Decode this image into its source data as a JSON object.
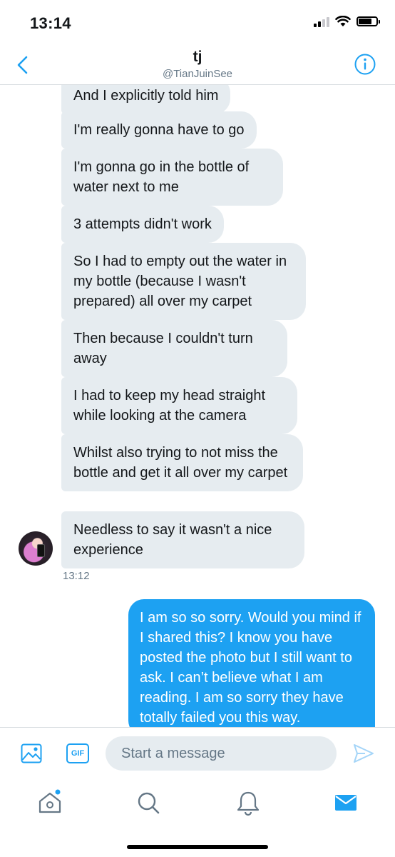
{
  "status_bar": {
    "time": "13:14",
    "battery_level": 0.75
  },
  "header": {
    "title": "tj",
    "handle": "@TianJuinSee"
  },
  "messages": [
    {
      "direction": "in",
      "text": "And I explicitly told him"
    },
    {
      "direction": "in",
      "text": "I'm really gonna have to go"
    },
    {
      "direction": "in",
      "text": "I'm gonna go in the bottle of water next to me"
    },
    {
      "direction": "in",
      "text": "3 attempts didn't work"
    },
    {
      "direction": "in",
      "text": "So I had to empty out the water in my bottle (because I wasn't prepared) all over my carpet"
    },
    {
      "direction": "in",
      "text": "Then because I couldn't turn away"
    },
    {
      "direction": "in",
      "text": "I had to keep my head straight while looking at the camera"
    },
    {
      "direction": "in",
      "text": "Whilst also trying to not miss the bottle and get it all over my carpet"
    },
    {
      "direction": "in",
      "text": "Needless to say it wasn't a nice experience"
    },
    {
      "direction": "out",
      "text": "I am so so sorry. Would you mind if I shared this? I know you have posted the photo but I still want to ask. I can’t believe what I am reading. I am so sorry they have totally failed you this way."
    }
  ],
  "incoming_timestamp": "13:12",
  "composer": {
    "gif_label": "GIF",
    "placeholder": "Start a message"
  },
  "icons": {
    "back": "chevron-left-icon",
    "info": "info-icon",
    "image": "image-icon",
    "gif": "gif-icon",
    "send": "send-icon",
    "home": "home-icon",
    "search": "search-icon",
    "notifications": "bell-icon",
    "messages": "mail-icon"
  },
  "colors": {
    "accent": "#1da1f2",
    "bubble_in": "#e6ecf0",
    "secondary_text": "#657786",
    "send_disabled": "#a5d5f8"
  }
}
